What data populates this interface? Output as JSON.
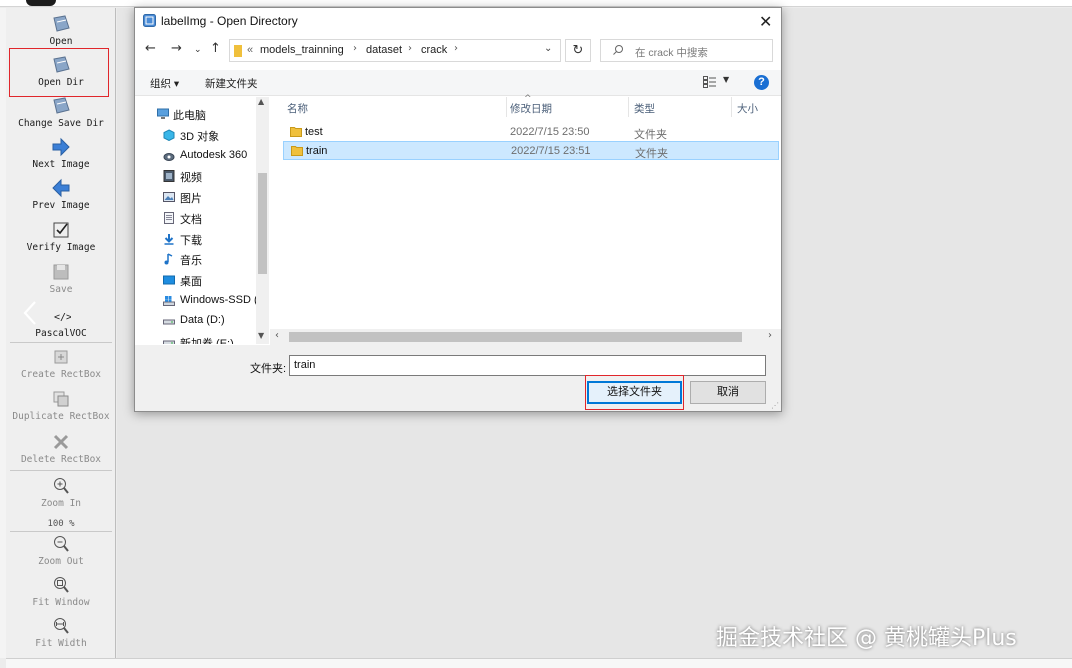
{
  "toolbar": {
    "items": [
      {
        "label": "Open",
        "icon": "open-file-icon"
      },
      {
        "label": "Open Dir",
        "icon": "open-dir-icon"
      },
      {
        "label": "Change Save Dir",
        "icon": "change-save-dir-icon"
      },
      {
        "label": "Next Image",
        "icon": "next-arrow-icon"
      },
      {
        "label": "Prev Image",
        "icon": "prev-arrow-icon"
      },
      {
        "label": "Verify Image",
        "icon": "verify-check-icon"
      },
      {
        "label": "Save",
        "icon": "save-icon"
      },
      {
        "label": "PascalVOC",
        "icon": "format-code-icon"
      },
      {
        "label": "Create RectBox",
        "icon": "create-rectbox-icon"
      },
      {
        "label": "Duplicate RectBox",
        "icon": "duplicate-rectbox-icon"
      },
      {
        "label": "Delete RectBox",
        "icon": "delete-rectbox-icon"
      },
      {
        "label": "Zoom In",
        "icon": "zoom-in-icon"
      },
      {
        "label": "Zoom Out",
        "icon": "zoom-out-icon"
      },
      {
        "label": "Fit Window",
        "icon": "fit-window-icon"
      },
      {
        "label": "Fit Width",
        "icon": "fit-width-icon"
      }
    ],
    "zoom_value": "100 %"
  },
  "dialog": {
    "title": "labelImg - Open Directory",
    "path": [
      "models_trainning",
      "dataset",
      "crack"
    ],
    "path_overflow": "«",
    "search_placeholder": "在 crack 中搜索",
    "organize": "组织 ▾",
    "new_folder": "新建文件夹",
    "nav_items": [
      {
        "label": "此电脑",
        "icon": "this-pc-icon"
      },
      {
        "label": "3D 对象",
        "icon": "3d-objects-icon"
      },
      {
        "label": "Autodesk 360",
        "icon": "cloud-drive-icon"
      },
      {
        "label": "视频",
        "icon": "videos-icon"
      },
      {
        "label": "图片",
        "icon": "pictures-icon"
      },
      {
        "label": "文档",
        "icon": "documents-icon"
      },
      {
        "label": "下载",
        "icon": "downloads-icon"
      },
      {
        "label": "音乐",
        "icon": "music-icon"
      },
      {
        "label": "桌面",
        "icon": "desktop-icon"
      },
      {
        "label": "Windows-SSD (",
        "icon": "windows-drive-icon"
      },
      {
        "label": "Data (D:)",
        "icon": "drive-icon"
      },
      {
        "label": "新加卷 (E:)",
        "icon": "drive-icon"
      }
    ],
    "columns": [
      "名称",
      "修改日期",
      "类型",
      "大小"
    ],
    "files": [
      {
        "name": "test",
        "date": "2022/7/15 23:50",
        "type": "文件夹",
        "selected": false
      },
      {
        "name": "train",
        "date": "2022/7/15 23:51",
        "type": "文件夹",
        "selected": true
      }
    ],
    "folder_label": "文件夹:",
    "folder_value": "train",
    "select_button": "选择文件夹",
    "cancel_button": "取消"
  },
  "watermark": "掘金技术社区 @ 黄桃罐头Plus",
  "colors": {
    "highlight_red": "#e0262b",
    "selection_bg": "#cce8ff",
    "accent_blue": "#0078d7",
    "folder_yellow": "#f0c03c"
  }
}
